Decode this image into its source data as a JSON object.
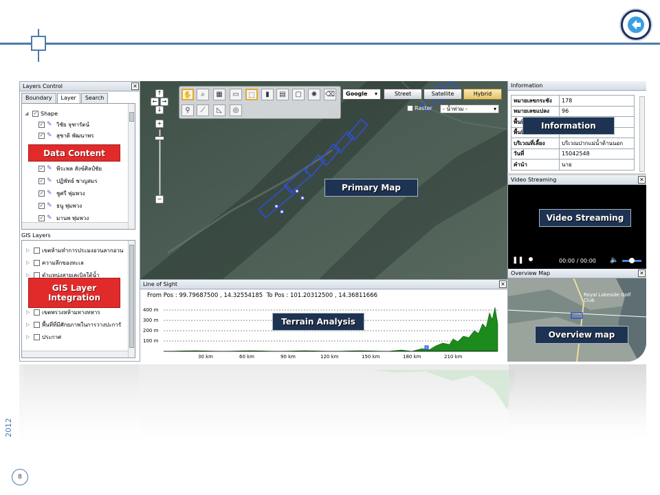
{
  "slide": {
    "year": "2012",
    "page_number": "8"
  },
  "layers_panel": {
    "title": "Layers Control",
    "tabs": [
      "Boundary",
      "Layer",
      "Search"
    ],
    "group_label": "Shape",
    "items": [
      "วิชัย จุฑารัตน์",
      "สุชาติ พัฒนาพร",
      "พีระพล สังข์ศิลป์ชัย",
      "ปฏิพัทธ์ ชาญสมร",
      "ชูศรี พุ่มพวง",
      "ธนู พุ่มพวง",
      "มานพ พุ่มพวง"
    ]
  },
  "gis_panel": {
    "title": "GIS Layers",
    "items": [
      "เขตห้ามทำการประมงอวนลากอวน",
      "ความลึกของทะเล",
      "ตำแหน่งสายเคเบิลใต้น้ำ",
      "",
      "",
      "เขตพรวงหห้ามทางทหาร",
      "พื้นที่ที่มีศักยภาพในการวางปะการั",
      "ประกาศ"
    ]
  },
  "labels": {
    "data_content": "Data Content",
    "gis_integration": "GIS Layer Integration",
    "primary_map": "Primary Map",
    "terrain_analysis": "Terrain Analysis",
    "information": "Information",
    "video_streaming": "Video Streaming",
    "overview_map": "Overview map"
  },
  "map": {
    "provider": "Google",
    "buttons": [
      "Street",
      "Satellite",
      "Hybrid"
    ],
    "active_button": "Hybrid",
    "raster_label": "Raster",
    "dropdown_value": "- น้ำท่วม -"
  },
  "line_of_sight": {
    "title": "Line of Sight",
    "from_label": "From Pos :",
    "from_value": "99.79687500 , 14.32554185",
    "to_label": "To Pos :",
    "to_value": "101.20312500 , 14.36811666",
    "y_ticks": [
      "400 m",
      "300 m",
      "200 m",
      "100 m"
    ],
    "x_ticks": [
      "30 km",
      "60 km",
      "90 km",
      "120 km",
      "150 km",
      "180 km",
      "210 km"
    ]
  },
  "info_panel": {
    "title": "Information",
    "rows": [
      {
        "key": "หมายเลขกระชัง",
        "value": "178"
      },
      {
        "key": "หมายเลขแปลง",
        "value": "96"
      },
      {
        "key": "พื้นที่",
        "value": ""
      },
      {
        "key": "พื้นที่",
        "value": ""
      },
      {
        "key": "บริเวณที่เลี้ยง",
        "value": "บริเวณปากแม่น้ำด้านนอก"
      },
      {
        "key": "วันที่",
        "value": "15042548"
      },
      {
        "key": "คำนำ",
        "value": "นาย"
      }
    ]
  },
  "video_panel": {
    "title": "Video Streaming",
    "time": "00:00 / 00:00"
  },
  "overview_panel": {
    "title": "Overview Map",
    "place_label": "Royal Lakeside Golf Club"
  },
  "colors": {
    "accent": "#4a7bab",
    "label_red": "#e12b2b",
    "label_dark": "#1e3352",
    "terrain_green": "#1d8a1d"
  }
}
